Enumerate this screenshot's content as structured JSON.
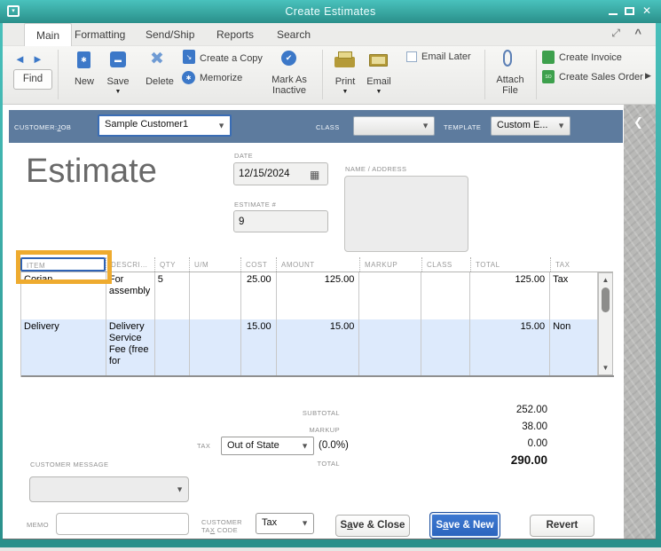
{
  "colors": {
    "titlebar_top": "#49c2bd",
    "titlebar_bottom": "#2a8f8a",
    "header_bar": "#5d7b9e",
    "highlight": "#eeab2f",
    "row_alt": "#ddeafc",
    "primary_button_top": "#3f7ad2",
    "primary_button_bottom": "#2a63bd"
  },
  "window": {
    "title": "Create Estimates",
    "minimize": "–",
    "close": "✕"
  },
  "tabs": [
    "Main",
    "Formatting",
    "Send/Ship",
    "Reports",
    "Search"
  ],
  "toolbar": {
    "find": "Find",
    "new": "New",
    "save": "Save",
    "delete": "Delete",
    "create_copy": "Create a Copy",
    "memorize": "Memorize",
    "mark_as": "Mark As",
    "inactive": "Inactive",
    "print": "Print",
    "email": "Email",
    "email_later": "Email Later",
    "attach_line1": "Attach",
    "attach_line2": "File",
    "create_invoice": "Create Invoice",
    "create_sales_order": "Create Sales Order"
  },
  "header_bar": {
    "customer_label": {
      "pre": "CUSTOMER:",
      "key": "J",
      "post": "OB"
    },
    "customer_value": "Sample Customer1",
    "class_label": "CLASS",
    "class_value": "",
    "template_label": "TEMPLATE",
    "template_value": "Custom E..."
  },
  "form": {
    "heading": "Estimate",
    "date_label": "DATE",
    "date_value": "12/15/2024",
    "estimate_label": "ESTIMATE #",
    "estimate_value": "9",
    "name_address_label": "NAME / ADDRESS"
  },
  "table": {
    "columns": [
      "ITEM",
      "DESCRI...",
      "QTY",
      "U/M",
      "COST",
      "AMOUNT",
      "MARKUP",
      "CLASS",
      "TOTAL",
      "TAX"
    ],
    "rows": [
      {
        "item": "Corian",
        "desc": "For assembly",
        "qty": "5",
        "um": "",
        "cost": "25.00",
        "amount": "125.00",
        "markup": "",
        "class": "",
        "total": "125.00",
        "tax": "Tax"
      },
      {
        "item": "Delivery",
        "desc": "Delivery Service Fee (free for",
        "qty": "",
        "um": "",
        "cost": "15.00",
        "amount": "15.00",
        "markup": "",
        "class": "",
        "total": "15.00",
        "tax": "Non"
      }
    ]
  },
  "totals": {
    "subtotal_label": "SUBTOTAL",
    "subtotal_value": "252.00",
    "markup_label": "MARKUP",
    "markup_value": "38.00",
    "tax_label": "TAX",
    "tax_value": "Out of State",
    "tax_rate": "(0.0%)",
    "tax_amount": "0.00",
    "total_label": "TOTAL",
    "total_value": "290.00"
  },
  "customer_message": {
    "label": "CUSTOMER MESSAGE",
    "value": ""
  },
  "footer": {
    "memo_label": "MEMO",
    "memo_value": "",
    "customer_tax_label_line1": "CUSTOMER",
    "customer_tax_label_line2": {
      "pre": "TA",
      "key": "X",
      "post": " CODE"
    },
    "tax_code_value": "Tax",
    "save_close": {
      "pre": "S",
      "key": "a",
      "post": "ve & Close"
    },
    "save_new": {
      "pre": "S",
      "key": "a",
      "post": "ve & New"
    },
    "revert": "Revert"
  }
}
